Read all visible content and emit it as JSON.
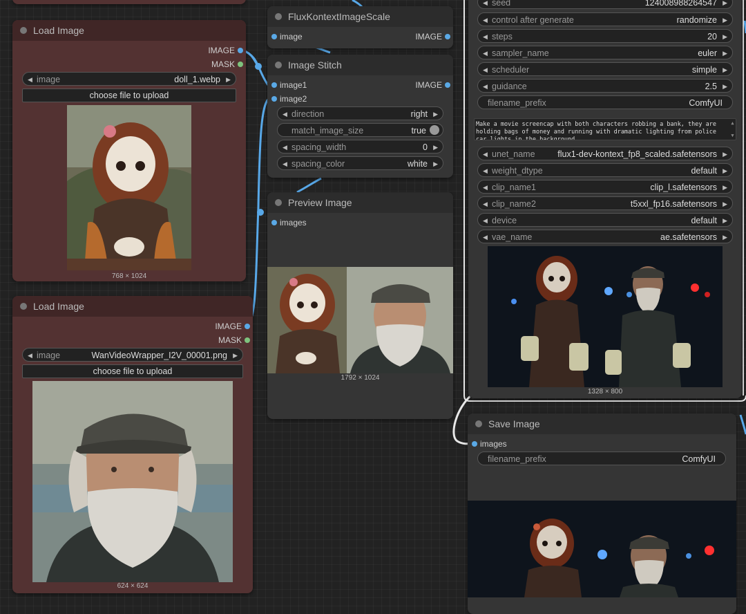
{
  "colors": {
    "image_slot": "#5aa9e6",
    "mask_slot": "#7ec37e",
    "wire": "#58a8e8",
    "wire_white": "#e8e8e8"
  },
  "nodes": {
    "load_image_1": {
      "title": "Load Image",
      "outputs": [
        "IMAGE",
        "MASK"
      ],
      "image_widget": {
        "label": "image",
        "value": "doll_1.webp"
      },
      "upload_label": "choose file to upload",
      "dimensions": "768 × 1024"
    },
    "load_image_2": {
      "title": "Load Image",
      "outputs": [
        "IMAGE",
        "MASK"
      ],
      "image_widget": {
        "label": "image",
        "value": "WanVideoWrapper_I2V_00001.png"
      },
      "upload_label": "choose file to upload",
      "dimensions": "624 × 624"
    },
    "flux_scale": {
      "title": "FluxKontextImageScale",
      "input": "image",
      "output": "IMAGE"
    },
    "image_stitch": {
      "title": "Image Stitch",
      "inputs": [
        "image1",
        "image2"
      ],
      "output": "IMAGE",
      "widgets": [
        {
          "label": "direction",
          "value": "right"
        },
        {
          "label": "match_image_size",
          "value": "true"
        },
        {
          "label": "spacing_width",
          "value": "0"
        },
        {
          "label": "spacing_color",
          "value": "white"
        }
      ]
    },
    "preview_image": {
      "title": "Preview Image",
      "input": "images",
      "dimensions": "1792 × 1024"
    },
    "sampler": {
      "widgets_top": [
        {
          "label": "seed",
          "value": "124008988264547"
        },
        {
          "label": "control after generate",
          "value": "randomize"
        },
        {
          "label": "steps",
          "value": "20"
        },
        {
          "label": "sampler_name",
          "value": "euler"
        },
        {
          "label": "scheduler",
          "value": "simple"
        },
        {
          "label": "guidance",
          "value": "2.5"
        },
        {
          "label": "filename_prefix",
          "value": "ComfyUI"
        }
      ],
      "prompt": "Make a movie screencap with both characters robbing a bank, they are holding bags of money and running with dramatic lighting from police car lights in the background",
      "widgets_bottom": [
        {
          "label": "unet_name",
          "value": "flux1-dev-kontext_fp8_scaled.safetensors"
        },
        {
          "label": "weight_dtype",
          "value": "default"
        },
        {
          "label": "clip_name1",
          "value": "clip_l.safetensors"
        },
        {
          "label": "clip_name2",
          "value": "t5xxl_fp16.safetensors"
        },
        {
          "label": "device",
          "value": "default"
        },
        {
          "label": "vae_name",
          "value": "ae.safetensors"
        }
      ],
      "dimensions": "1328 × 800"
    },
    "save_image": {
      "title": "Save Image",
      "input": "images",
      "widget": {
        "label": "filename_prefix",
        "value": "ComfyUI"
      }
    }
  }
}
